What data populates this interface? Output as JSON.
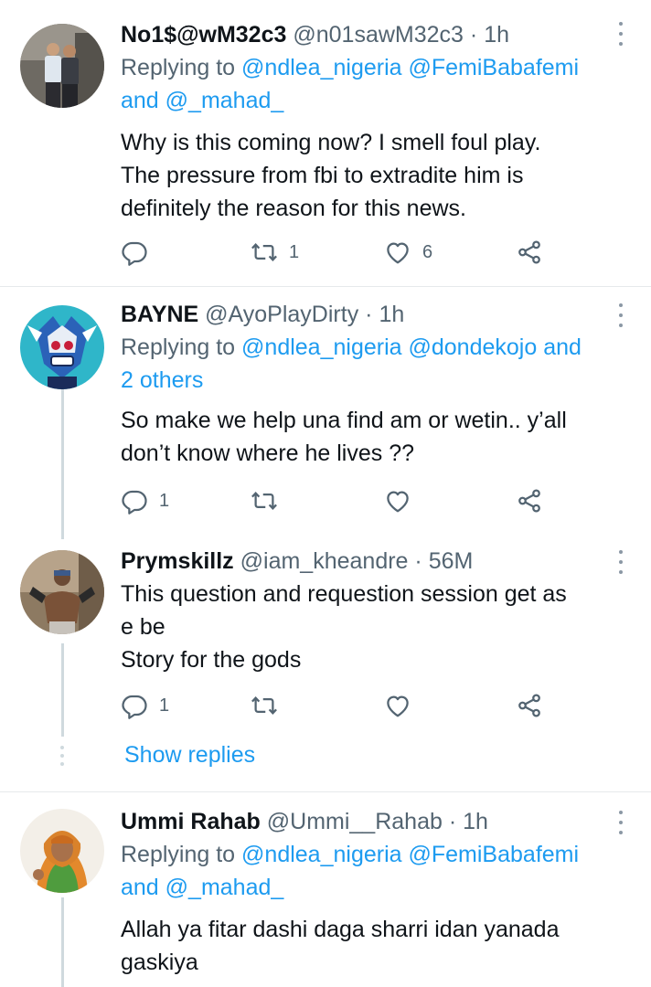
{
  "tweets": [
    {
      "name": "No1$@wM32c3",
      "handle": "@n01sawM32c3",
      "dot": "·",
      "time": "1h",
      "replying_prefix": "Replying to",
      "mention1": "@ndlea_nigeria",
      "mention2": "@FemiBabafemi",
      "and_text": "and",
      "mention3": "@_mahad_",
      "lines": [
        "Why is this coming now? I smell foul play.",
        "The pressure from fbi to extradite him is",
        "definitely the reason for this news."
      ],
      "reply_count": "",
      "retweet_count": "1",
      "like_count": "6"
    },
    {
      "name": "BAYNE",
      "handle": "@AyoPlayDirty",
      "dot": "·",
      "time": "1h",
      "replying_prefix": "Replying to",
      "mention1": "@ndlea_nigeria",
      "mention2": "@dondekojo",
      "and_text": "and",
      "others": "2 others",
      "lines": [
        "So make we help una find am or wetin.. y’all",
        "don’t know where he lives ??"
      ],
      "reply_count": "1",
      "retweet_count": "",
      "like_count": ""
    },
    {
      "name": "Prymskillz",
      "handle": "@iam_kheandre",
      "dot": "·",
      "time": "56M",
      "lines": [
        "This question and requestion session get as",
        "e be",
        "Story for the gods"
      ],
      "reply_count": "1",
      "retweet_count": "",
      "like_count": ""
    },
    {
      "name": "Ummi Rahab",
      "handle": "@Ummi__Rahab",
      "dot": "·",
      "time": "1h",
      "replying_prefix": "Replying to",
      "mention1": "@ndlea_nigeria",
      "mention2": "@FemiBabafemi",
      "and_text": "and",
      "mention3": "@_mahad_",
      "lines": [
        "Allah ya fitar dashi daga sharri idan yanada",
        "gaskiya"
      ]
    }
  ],
  "show_replies": "Show replies",
  "colors": {
    "link": "#1d9bf0",
    "secondary": "#536471",
    "text": "#0f1419"
  },
  "icons": [
    "reply-icon",
    "retweet-icon",
    "like-icon",
    "share-icon",
    "more-options-icon"
  ]
}
